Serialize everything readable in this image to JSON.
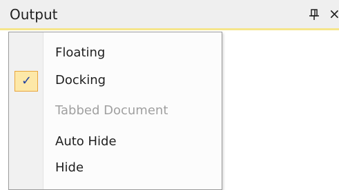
{
  "panel": {
    "title": "Output",
    "pin_icon": "pin-icon",
    "close_label": "×"
  },
  "menu": {
    "items": [
      {
        "label": "Floating",
        "checked": false,
        "enabled": true
      },
      {
        "label": "Docking",
        "checked": true,
        "enabled": true
      },
      {
        "label": "Tabbed Document",
        "checked": false,
        "enabled": false
      },
      {
        "label": "Auto Hide",
        "checked": false,
        "enabled": true
      },
      {
        "label": "Hide",
        "checked": false,
        "enabled": true
      }
    ],
    "check_glyph": "✓"
  },
  "colors": {
    "accent_border": "#f5e58a",
    "check_background": "#fde8a8",
    "check_border": "#e8a53c",
    "check_mark": "#1f3f9f",
    "disabled_text": "#a0a0a0"
  }
}
